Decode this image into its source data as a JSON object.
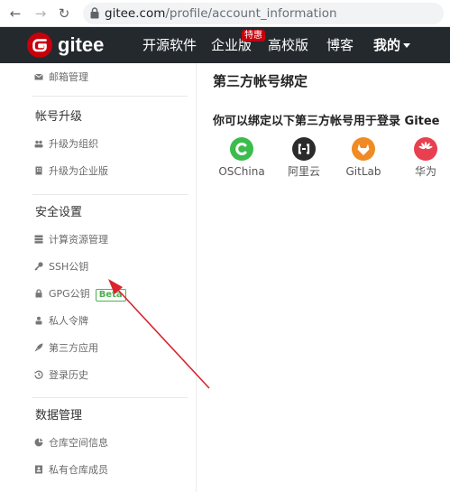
{
  "browser": {
    "url_host": "gitee.com",
    "url_path": "/profile/account_information",
    "back_icon": "arrow-left-icon",
    "forward_icon": "arrow-right-icon",
    "reload_icon": "reload-icon",
    "lock_icon": "lock-icon"
  },
  "header": {
    "brand": "gitee",
    "nav": {
      "opensource": "开源软件",
      "enterprise": "企业版",
      "enterprise_badge": "特惠",
      "university": "高校版",
      "blog": "博客",
      "me": "我的"
    },
    "colors": {
      "bg": "#24292e",
      "logo": "#c7000b"
    }
  },
  "sidebar": {
    "email_manage": "邮箱管理",
    "section_upgrade": "帐号升级",
    "upgrade_org": "升级为组织",
    "upgrade_enterprise": "升级为企业版",
    "section_security": "安全设置",
    "compute_resources": "计算资源管理",
    "ssh_keys": "SSH公钥",
    "gpg_keys": "GPG公钥",
    "gpg_badge": "Beta",
    "private_token": "私人令牌",
    "third_party_apps": "第三方应用",
    "login_history": "登录历史",
    "section_data": "数据管理",
    "repo_space": "仓库空间信息",
    "private_repo_members": "私有仓库成员"
  },
  "main": {
    "title": "第三方帐号绑定",
    "bind_desc": "你可以绑定以下第三方帐号用于登录 Gitee",
    "providers": [
      {
        "name": "OSChina",
        "color": "#3cbc4c",
        "icon": "oschina-icon"
      },
      {
        "name": "阿里云",
        "color": "#2b2b2b",
        "icon": "aliyun-icon"
      },
      {
        "name": "GitLab",
        "color": "#f08a24",
        "icon": "gitlab-icon"
      },
      {
        "name": "华为",
        "color": "#e8404f",
        "icon": "huawei-icon"
      }
    ]
  }
}
